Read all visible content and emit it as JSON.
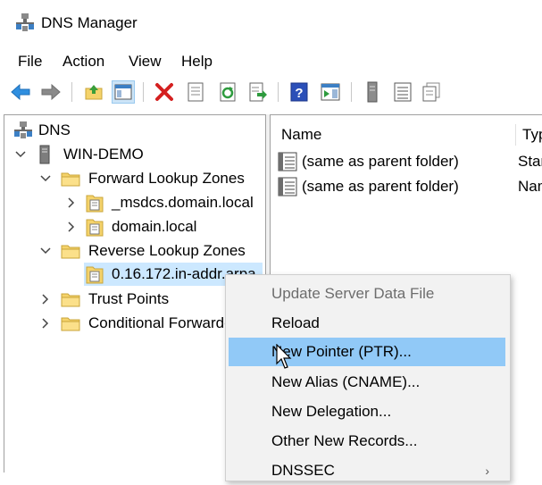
{
  "window": {
    "title": "DNS Manager"
  },
  "menu": [
    "File",
    "Action",
    "View",
    "Help"
  ],
  "toolbar": {
    "icons": [
      "back-icon",
      "forward-icon",
      "up-folder-icon",
      "show-hide-console-tree-icon",
      "delete-icon",
      "properties-icon",
      "refresh-icon",
      "export-list-icon",
      "help-icon",
      "action-pane-icon",
      "server-icon",
      "list-view-icon",
      "record-icon"
    ]
  },
  "tree": {
    "root": "DNS",
    "server": "WIN-DEMO",
    "forward": "Forward Lookup Zones",
    "forward_children": [
      "_msdcs.domain.local",
      "domain.local"
    ],
    "reverse": "Reverse Lookup Zones",
    "reverse_child": "0.16.172.in-addr.arpa",
    "trust": "Trust Points",
    "conditional": "Conditional Forwarders"
  },
  "list": {
    "columns": [
      "Name",
      "Type"
    ],
    "rows": [
      {
        "name": "(same as parent folder)",
        "type": "Start of Authority (SOA)"
      },
      {
        "name": "(same as parent folder)",
        "type": "Name Server (NS)"
      }
    ]
  },
  "context_menu": {
    "items": [
      {
        "label": "Update Server Data File",
        "disabled": true
      },
      {
        "label": "Reload"
      },
      {
        "label": "New Pointer (PTR)...",
        "highlighted": true
      },
      {
        "label": "New Alias (CNAME)..."
      },
      {
        "label": "New Delegation..."
      },
      {
        "label": "Other New Records..."
      },
      {
        "label": "DNSSEC",
        "submenu": true
      }
    ]
  },
  "colors": {
    "selection": "#cce8ff",
    "menu_highlight": "#91c9f7",
    "folder": "#f5d36b"
  }
}
